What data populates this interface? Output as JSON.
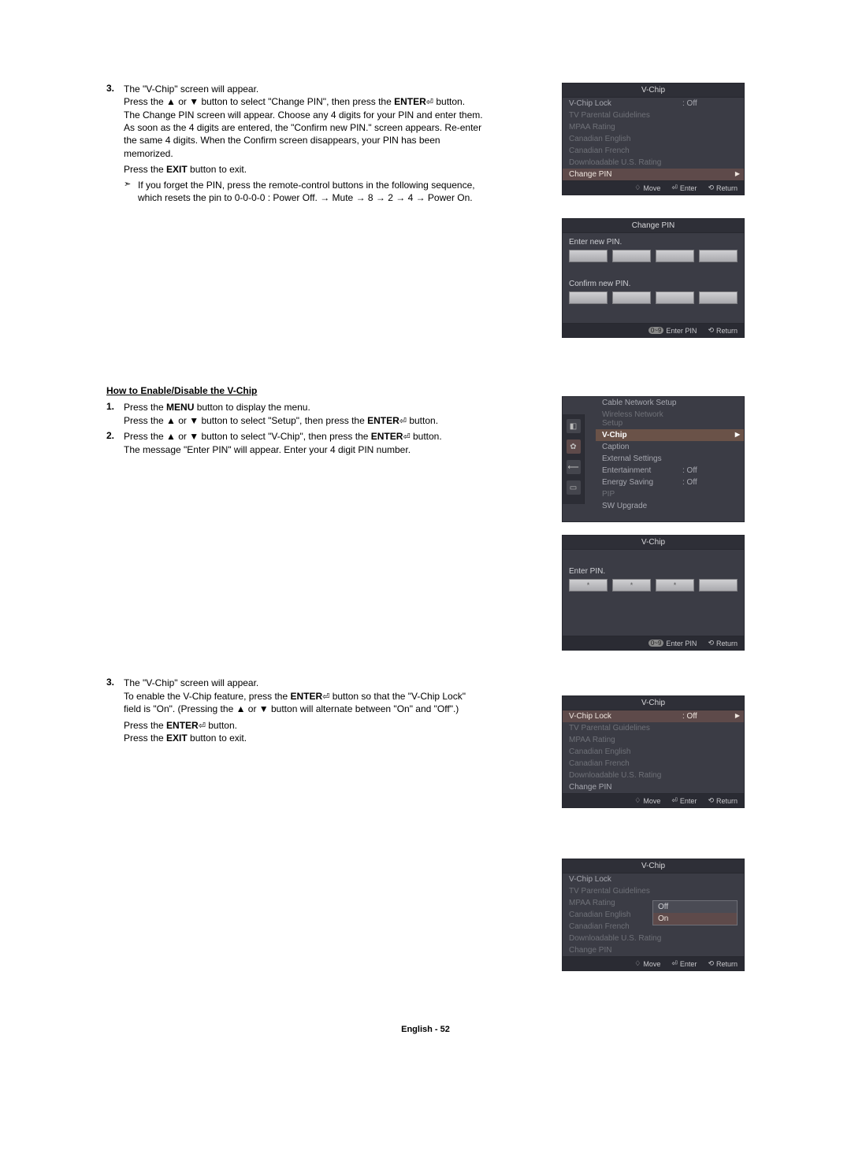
{
  "step3a": {
    "num": "3.",
    "line1": "The \"V-Chip\" screen will appear.",
    "line2_a": "Press the ▲ or ▼ button to select \"Change PIN\", then press the ",
    "line2_b": "ENTER",
    "line2_c": " button. The Change PIN screen will appear. Choose any 4 digits for your PIN and enter them. As soon as the 4 digits are entered, the \"Confirm new PIN.\" screen appears. Re-enter the same 4 digits. When the Confirm screen disappears, your PIN has been memorized.",
    "line3_a": "Press the ",
    "line3_b": "EXIT",
    "line3_c": " button to exit.",
    "note": "If you forget the PIN, press the remote-control buttons in the following sequence, which resets the pin to 0-0-0-0 : Power Off. → Mute → 8 → 2 → 4 → Power On."
  },
  "sectionB_title": "How to Enable/Disable the V-Chip",
  "step1b": {
    "num": "1.",
    "line1_a": "Press the ",
    "line1_b": "MENU",
    "line1_c": " button to display the menu.",
    "line2_a": "Press the ▲ or ▼ button to select \"Setup\", then press the ",
    "line2_b": "ENTER",
    "line2_c": " button."
  },
  "step2b": {
    "num": "2.",
    "line1_a": "Press the ▲ or ▼ button to select \"V-Chip\", then press the ",
    "line1_b": "ENTER",
    "line1_c": " button.",
    "line2": "The message \"Enter PIN\" will appear. Enter your 4 digit PIN number."
  },
  "step3b": {
    "num": "3.",
    "line1": "The \"V-Chip\" screen will appear.",
    "line2_a": "To enable the V-Chip feature, press the ",
    "line2_b": "ENTER",
    "line2_c": " button so that the \"V-Chip Lock\" field is \"On\". (Pressing the ▲ or ▼ button will alternate between \"On\" and \"Off\".)",
    "line3_a": "Press the ",
    "line3_b": "ENTER",
    "line3_c": " button.",
    "line4_a": "Press the ",
    "line4_b": "EXIT",
    "line4_c": " button to exit."
  },
  "footer": "English - 52",
  "enter_glyph": "⏎",
  "note_glyph": "➣",
  "osd_vchip1": {
    "title": "V-Chip",
    "items": [
      {
        "lbl": "V-Chip Lock",
        "val": ": Off",
        "dim": false
      },
      {
        "lbl": "TV Parental Guidelines",
        "val": "",
        "dim": true
      },
      {
        "lbl": "MPAA Rating",
        "val": "",
        "dim": true
      },
      {
        "lbl": "Canadian English",
        "val": "",
        "dim": true
      },
      {
        "lbl": "Canadian French",
        "val": "",
        "dim": true
      },
      {
        "lbl": "Downloadable U.S. Rating",
        "val": "",
        "dim": true
      },
      {
        "lbl": "Change PIN",
        "val": "",
        "hl": true
      }
    ],
    "bar": {
      "move": "Move",
      "enter": "Enter",
      "return": "Return"
    }
  },
  "osd_changepin": {
    "title": "Change PIN",
    "field1": "Enter new PIN.",
    "field2": "Confirm new PIN.",
    "bar": {
      "pill": "0~9",
      "enter": "Enter PIN",
      "return": "Return"
    }
  },
  "osd_setup": {
    "side_label": "Setup",
    "items": [
      {
        "lbl": "Cable Network Setup",
        "val": "",
        "dim": false
      },
      {
        "lbl": "Wireless Network Setup",
        "val": "",
        "dim": true
      },
      {
        "lbl": "V-Chip",
        "val": "",
        "hl": true,
        "strong": true
      },
      {
        "lbl": "Caption",
        "val": "",
        "dim": false
      },
      {
        "lbl": "External Settings",
        "val": "",
        "dim": false
      },
      {
        "lbl": "Entertainment",
        "val": ": Off",
        "dim": false
      },
      {
        "lbl": "Energy Saving",
        "val": ": Off",
        "dim": false
      },
      {
        "lbl": "PIP",
        "val": "",
        "dim": true
      },
      {
        "lbl": "SW Upgrade",
        "val": "",
        "dim": false
      }
    ]
  },
  "osd_enterpin": {
    "title": "V-Chip",
    "field1": "Enter PIN.",
    "dots": [
      "*",
      "*",
      "*",
      ""
    ],
    "bar": {
      "pill": "0~9",
      "enter": "Enter PIN",
      "return": "Return"
    }
  },
  "osd_vchip2": {
    "title": "V-Chip",
    "items": [
      {
        "lbl": "V-Chip Lock",
        "val": ": Off",
        "hl": true
      },
      {
        "lbl": "TV Parental Guidelines",
        "val": "",
        "dim": true
      },
      {
        "lbl": "MPAA Rating",
        "val": "",
        "dim": true
      },
      {
        "lbl": "Canadian English",
        "val": "",
        "dim": true
      },
      {
        "lbl": "Canadian French",
        "val": "",
        "dim": true
      },
      {
        "lbl": "Downloadable U.S. Rating",
        "val": "",
        "dim": true
      },
      {
        "lbl": "Change PIN",
        "val": "",
        "dim": false
      }
    ],
    "bar": {
      "move": "Move",
      "enter": "Enter",
      "return": "Return"
    }
  },
  "osd_vchip3": {
    "title": "V-Chip",
    "items": [
      {
        "lbl": "V-Chip Lock",
        "val": "",
        "dim": false
      },
      {
        "lbl": "TV Parental Guidelines",
        "val": "",
        "dim": true
      },
      {
        "lbl": "MPAA Rating",
        "val": "",
        "dim": true
      },
      {
        "lbl": "Canadian English",
        "val": "",
        "dim": true
      },
      {
        "lbl": "Canadian French",
        "val": "",
        "dim": true
      },
      {
        "lbl": "Downloadable U.S. Rating",
        "val": "",
        "dim": true
      },
      {
        "lbl": "Change PIN",
        "val": "",
        "dim": true
      }
    ],
    "dropdown": {
      "options": [
        "Off",
        "On"
      ],
      "selected": "On"
    },
    "bar": {
      "move": "Move",
      "enter": "Enter",
      "return": "Return"
    }
  }
}
